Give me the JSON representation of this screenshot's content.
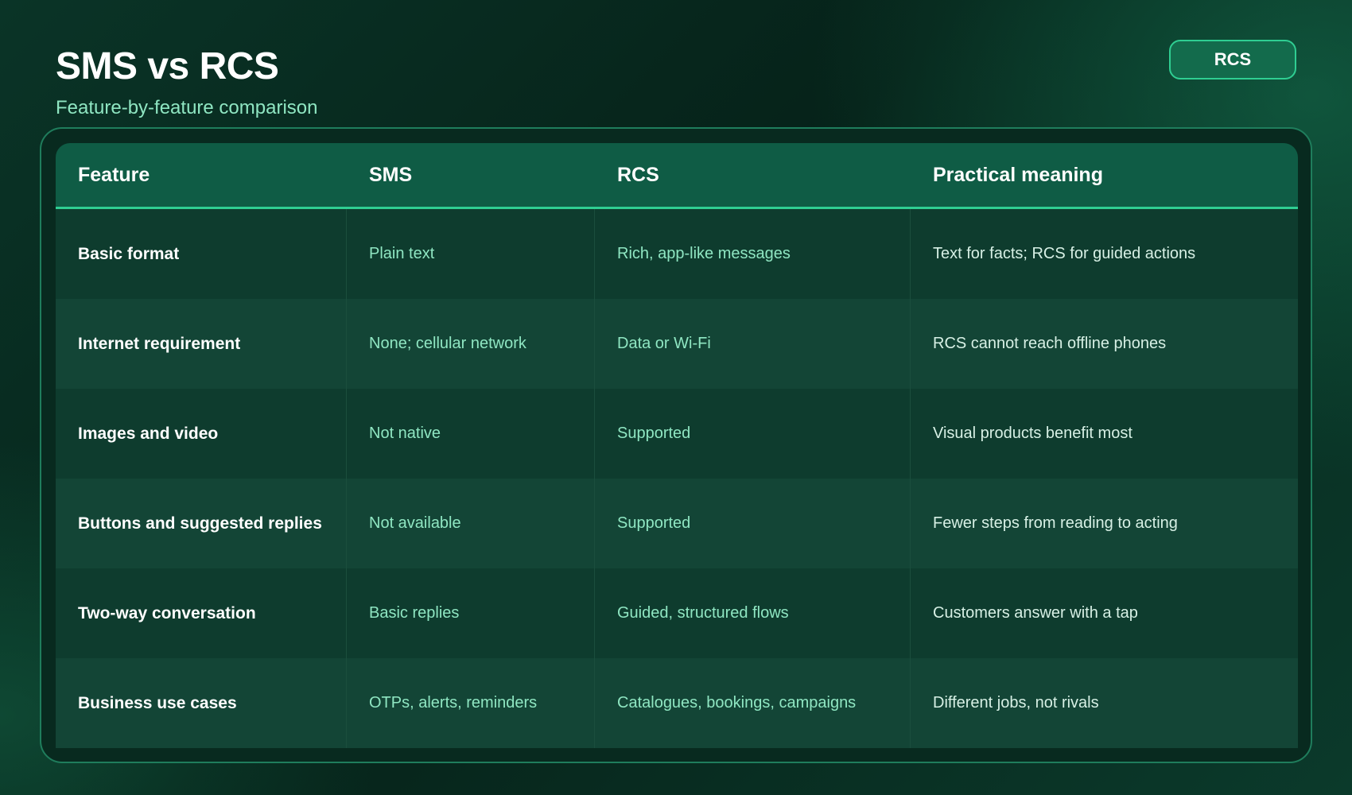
{
  "header": {
    "title": "SMS vs RCS",
    "subtitle": "Feature-by-feature comparison",
    "badge": "RCS"
  },
  "table": {
    "columns": [
      "Feature",
      "SMS",
      "RCS",
      "Practical meaning"
    ],
    "rows": [
      {
        "feature": "Basic format",
        "sms": "Plain text",
        "rcs": "Rich, app-like messages",
        "meaning": "Text for facts; RCS for guided actions"
      },
      {
        "feature": "Internet requirement",
        "sms": "None; cellular network",
        "rcs": "Data or Wi-Fi",
        "meaning": "RCS cannot reach offline phones"
      },
      {
        "feature": "Images and video",
        "sms": "Not native",
        "rcs": "Supported",
        "meaning": "Visual products benefit most"
      },
      {
        "feature": "Buttons and suggested replies",
        "sms": "Not available",
        "rcs": "Supported",
        "meaning": "Fewer steps from reading to acting"
      },
      {
        "feature": "Two-way conversation",
        "sms": "Basic replies",
        "rcs": "Guided, structured flows",
        "meaning": "Customers answer with a tap"
      },
      {
        "feature": "Business use cases",
        "sms": "OTPs, alerts, reminders",
        "rcs": "Catalogues, bookings, campaigns",
        "meaning": "Different jobs, not rivals"
      }
    ]
  },
  "colors": {
    "accent": "#2fce92",
    "header_bg": "#0f5c45",
    "text_light_green": "#8fe6c2"
  }
}
